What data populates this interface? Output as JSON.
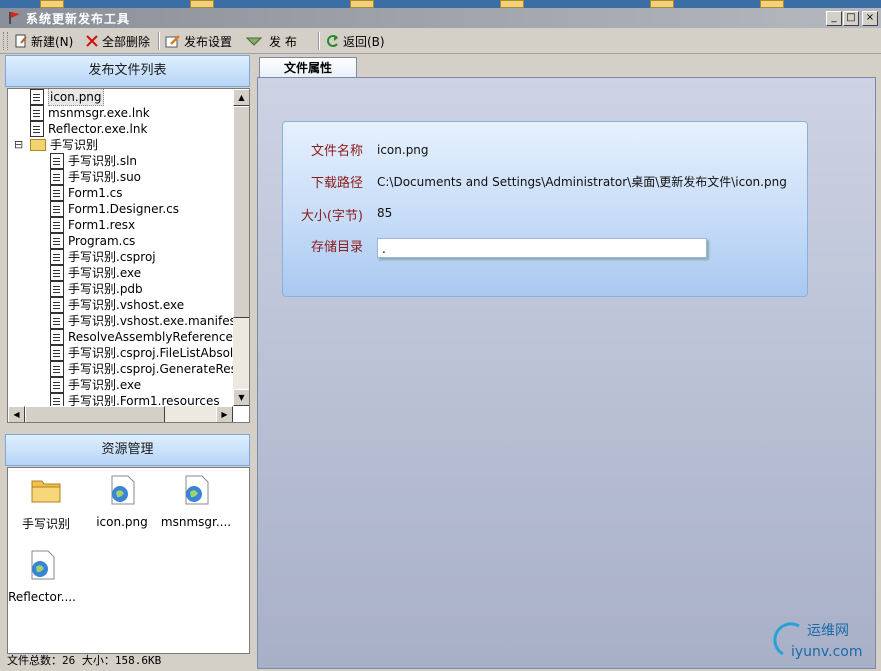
{
  "window": {
    "title": "系统更新发布工具"
  },
  "title_buttons": {
    "minimize": "_",
    "maximize": "□",
    "close": "×"
  },
  "toolbar": {
    "new_label": "新建(N)",
    "delete_all_label": "全部删除",
    "settings_label": "发布设置",
    "publish_label": "发 布",
    "back_label": "返回(B)"
  },
  "left": {
    "file_list_header": "发布文件列表",
    "tree": [
      {
        "label": "icon.png",
        "level": 0,
        "type": "file",
        "selected": true
      },
      {
        "label": "msnmsgr.exe.lnk",
        "level": 0,
        "type": "file"
      },
      {
        "label": "Reflector.exe.lnk",
        "level": 0,
        "type": "file"
      },
      {
        "label": "手写识别",
        "level": 0,
        "type": "folder",
        "expanded": true
      },
      {
        "label": "手写识别.sln",
        "level": 1,
        "type": "file"
      },
      {
        "label": "手写识别.suo",
        "level": 1,
        "type": "file"
      },
      {
        "label": "Form1.cs",
        "level": 1,
        "type": "file"
      },
      {
        "label": "Form1.Designer.cs",
        "level": 1,
        "type": "file"
      },
      {
        "label": "Form1.resx",
        "level": 1,
        "type": "file"
      },
      {
        "label": "Program.cs",
        "level": 1,
        "type": "file"
      },
      {
        "label": "手写识别.csproj",
        "level": 1,
        "type": "file"
      },
      {
        "label": "手写识别.exe",
        "level": 1,
        "type": "file"
      },
      {
        "label": "手写识别.pdb",
        "level": 1,
        "type": "file"
      },
      {
        "label": "手写识别.vshost.exe",
        "level": 1,
        "type": "file"
      },
      {
        "label": "手写识别.vshost.exe.manifest",
        "level": 1,
        "type": "file"
      },
      {
        "label": "ResolveAssemblyReference.cache",
        "level": 1,
        "type": "file"
      },
      {
        "label": "手写识别.csproj.FileListAbsolute.txt",
        "level": 1,
        "type": "file"
      },
      {
        "label": "手写识别.csproj.GenerateResource.Cache",
        "level": 1,
        "type": "file"
      },
      {
        "label": "手写识别.exe",
        "level": 1,
        "type": "file"
      },
      {
        "label": "手写识别.Form1.resources",
        "level": 1,
        "type": "file"
      }
    ],
    "resource_header": "资源管理",
    "resources": [
      {
        "label": "手写识别",
        "icon": "folder-icon"
      },
      {
        "label": "icon.png",
        "icon": "globe-file-icon"
      },
      {
        "label": "msnmsgr....",
        "icon": "globe-file-icon"
      },
      {
        "label": "Reflector....",
        "icon": "globe-file-icon"
      }
    ],
    "status": "文件总数：26 大小：158.6KB"
  },
  "right": {
    "tab_label": "文件属性",
    "props": {
      "name_label": "文件名称",
      "name_value": "icon.png",
      "path_label": "下载路径",
      "path_value": "C:\\Documents and Settings\\Administrator\\桌面\\更新发布文件\\icon.png",
      "size_label": "大小(字节)",
      "size_value": "85",
      "dir_label": "存储目录",
      "dir_value": "."
    }
  },
  "watermark": {
    "brand": "运维网",
    "url": "iyunv.com"
  }
}
